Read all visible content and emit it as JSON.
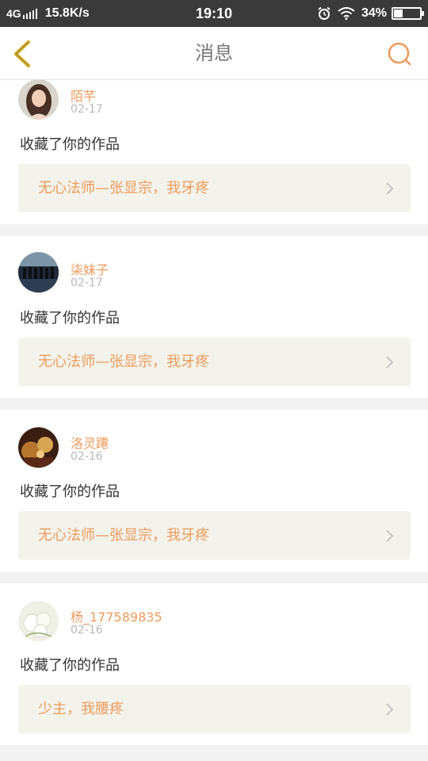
{
  "status_bar": {
    "network": "4G",
    "speed": "15.8K/s",
    "time": "19:10",
    "battery": "34%",
    "battery_level": 0.34
  },
  "nav": {
    "title": "消息",
    "back_icon": "chevron-left-icon",
    "search_icon": "search-icon"
  },
  "messages": [
    {
      "username": "陌芊",
      "date": "02-17",
      "action": "收藏了你的作品",
      "work": "无心法师—张显宗，我牙疼"
    },
    {
      "username": "柒妹子",
      "date": "02-17",
      "action": "收藏了你的作品",
      "work": "无心法师—张显宗，我牙疼"
    },
    {
      "username": "洛灵蹮",
      "date": "02-16",
      "action": "收藏了你的作品",
      "work": "无心法师—张显宗，我牙疼"
    },
    {
      "username": "杨_177589835",
      "date": "02-16",
      "action": "收藏了你的作品",
      "work": "少主，我腰疼"
    }
  ],
  "colors": {
    "accent_orange": "#ee9a5c",
    "back_arrow": "#d9b22b",
    "status_bar_bg": "#3a3a3a",
    "link_bg": "#f3f3eb"
  }
}
